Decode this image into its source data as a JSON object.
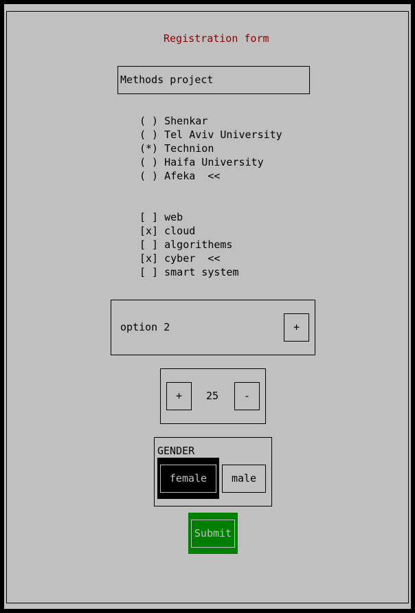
{
  "form": {
    "title": "Registration form",
    "text_field_value": "Methods project"
  },
  "radio_group": {
    "items": [
      {
        "mark": "( )",
        "label": "Shenkar",
        "cursor": ""
      },
      {
        "mark": "( )",
        "label": "Tel Aviv University",
        "cursor": ""
      },
      {
        "mark": "(*)",
        "label": "Technion",
        "cursor": ""
      },
      {
        "mark": "( )",
        "label": "Haifa University",
        "cursor": ""
      },
      {
        "mark": "( )",
        "label": "Afeka",
        "cursor": "  <<"
      }
    ]
  },
  "checkbox_group": {
    "items": [
      {
        "mark": "[ ]",
        "label": "web",
        "cursor": ""
      },
      {
        "mark": "[x]",
        "label": "cloud",
        "cursor": ""
      },
      {
        "mark": "[ ]",
        "label": "algorithems",
        "cursor": ""
      },
      {
        "mark": "[x]",
        "label": "cyber",
        "cursor": "  <<"
      },
      {
        "mark": "[ ]",
        "label": "smart system",
        "cursor": ""
      }
    ]
  },
  "dropdown": {
    "value": "option 2",
    "expand_label": "+"
  },
  "stepper": {
    "plus_label": "+",
    "value": "25",
    "minus_label": "-"
  },
  "gender": {
    "label": "GENDER",
    "options": [
      "female",
      "male"
    ],
    "selected": "female"
  },
  "submit": {
    "label": "Submit"
  },
  "colors": {
    "background": "#c0c0c0",
    "title": "#8b0000",
    "selected": "#000000",
    "submit": "#008000"
  }
}
